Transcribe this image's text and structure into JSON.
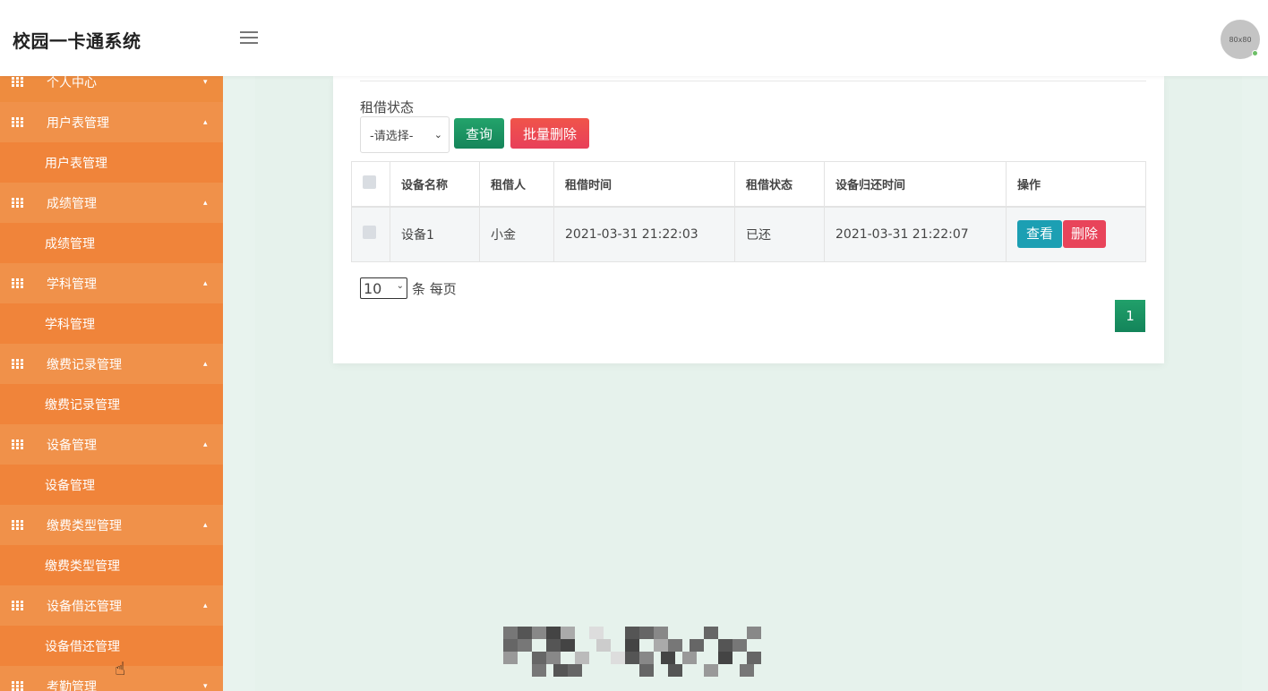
{
  "header": {
    "app_title": "校园一卡通系统",
    "avatar_text": "80x80"
  },
  "sidebar": {
    "groups": [
      {
        "title": "个人中心",
        "caret": "▾",
        "sub": null
      },
      {
        "title": "用户表管理",
        "caret": "▴",
        "sub": "用户表管理"
      },
      {
        "title": "成绩管理",
        "caret": "▴",
        "sub": "成绩管理"
      },
      {
        "title": "学科管理",
        "caret": "▴",
        "sub": "学科管理"
      },
      {
        "title": "缴费记录管理",
        "caret": "▴",
        "sub": "缴费记录管理"
      },
      {
        "title": "设备管理",
        "caret": "▴",
        "sub": "设备管理"
      },
      {
        "title": "缴费类型管理",
        "caret": "▴",
        "sub": "缴费类型管理"
      },
      {
        "title": "设备借还管理",
        "caret": "▴",
        "sub": "设备借还管理"
      },
      {
        "title": "考勤管理",
        "caret": "▾",
        "sub": null
      }
    ]
  },
  "filter": {
    "label": "租借状态",
    "select_value": "-请选择-",
    "query_btn": "查询",
    "batch_delete_btn": "批量删除"
  },
  "table": {
    "headers": [
      "设备名称",
      "租借人",
      "租借时间",
      "租借状态",
      "设备归还时间",
      "操作"
    ],
    "rows": [
      {
        "name": "设备1",
        "borrower": "小金",
        "borrow_time": "2021-03-31 21:22:03",
        "status": "已还",
        "return_time": "2021-03-31 21:22:07",
        "view_btn": "查看",
        "delete_btn": "删除"
      }
    ]
  },
  "pagination": {
    "page_size": "10",
    "per_page_text": "条 每页",
    "current_page": "1"
  },
  "colors": {
    "sidebar": "#ee8a3d",
    "primary_green": "#1a9463",
    "danger": "#e8445a",
    "info": "#1c9fb3",
    "content_bg": "#e6f2ec"
  }
}
